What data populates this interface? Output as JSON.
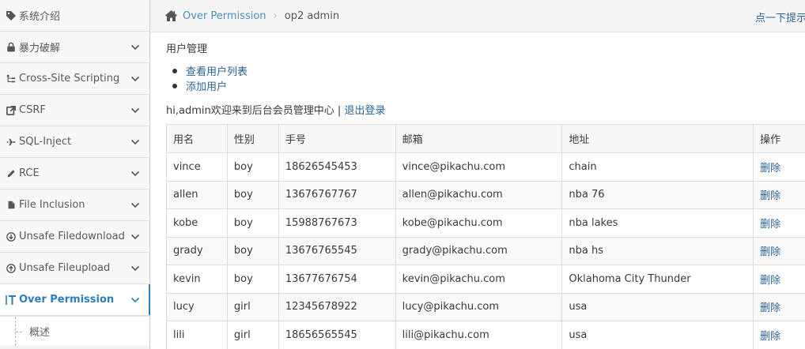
{
  "sidebar": {
    "items": [
      {
        "label": "系统介绍",
        "icon": "tags-icon",
        "name": "sidebar-item-intro",
        "has_chevron": false
      },
      {
        "label": "暴力破解",
        "icon": "lock-icon",
        "name": "sidebar-item-burteforce",
        "has_chevron": true
      },
      {
        "label": "Cross-Site Scripting",
        "icon": "sitemap-icon",
        "name": "sidebar-item-xss",
        "has_chevron": true
      },
      {
        "label": "CSRF",
        "icon": "external-link-icon",
        "name": "sidebar-item-csrf",
        "has_chevron": true
      },
      {
        "label": "SQL-Inject",
        "icon": "plane-icon",
        "name": "sidebar-item-sqli",
        "has_chevron": true
      },
      {
        "label": "RCE",
        "icon": "pencil-icon",
        "name": "sidebar-item-rce",
        "has_chevron": true
      },
      {
        "label": "File Inclusion",
        "icon": "file-icon",
        "name": "sidebar-item-file-inclusion",
        "has_chevron": true
      },
      {
        "label": "Unsafe Filedownload",
        "icon": "download-circle-icon",
        "name": "sidebar-item-unsafe-download",
        "has_chevron": true
      },
      {
        "label": "Unsafe Fileupload",
        "icon": "upload-circle-icon",
        "name": "sidebar-item-unsafe-upload",
        "has_chevron": true
      },
      {
        "label": "Over Permission",
        "icon": "text-cursor-icon",
        "name": "sidebar-item-over-permission",
        "has_chevron": true,
        "active": true
      }
    ],
    "sub_items": [
      {
        "label": "概述"
      }
    ]
  },
  "breadcrumb": {
    "home_link": "Over Permission",
    "current": "op2 admin",
    "hint": "点一下提示~"
  },
  "main": {
    "section_title": "用户管理",
    "links": [
      "查看用户列表",
      "添加用户"
    ],
    "welcome_text": "hi,admin欢迎来到后台会员管理中心 | ",
    "logout_link": "退出登录"
  },
  "table": {
    "headers": [
      "用名",
      "性别",
      "手号",
      "邮箱",
      "地址",
      "操作"
    ],
    "rows": [
      [
        "vince",
        "boy",
        "18626545453",
        "vince@pikachu.com",
        "chain",
        "删除"
      ],
      [
        "allen",
        "boy",
        "13676767767",
        "allen@pikachu.com",
        "nba 76",
        "删除"
      ],
      [
        "kobe",
        "boy",
        "15988767673",
        "kobe@pikachu.com",
        "nba lakes",
        "删除"
      ],
      [
        "grady",
        "boy",
        "13676765545",
        "grady@pikachu.com",
        "nba hs",
        "删除"
      ],
      [
        "kevin",
        "boy",
        "13677676754",
        "kevin@pikachu.com",
        "Oklahoma City Thunder",
        "删除"
      ],
      [
        "lucy",
        "girl",
        "12345678922",
        "lucy@pikachu.com",
        "usa",
        "删除"
      ],
      [
        "lili",
        "girl",
        "18656565545",
        "lili@pikachu.com",
        "usa",
        "删除"
      ]
    ]
  },
  "colors": {
    "accent": "#2b7dbc",
    "link": "#2a6496",
    "sidebar_bg": "#f8f8f8"
  }
}
